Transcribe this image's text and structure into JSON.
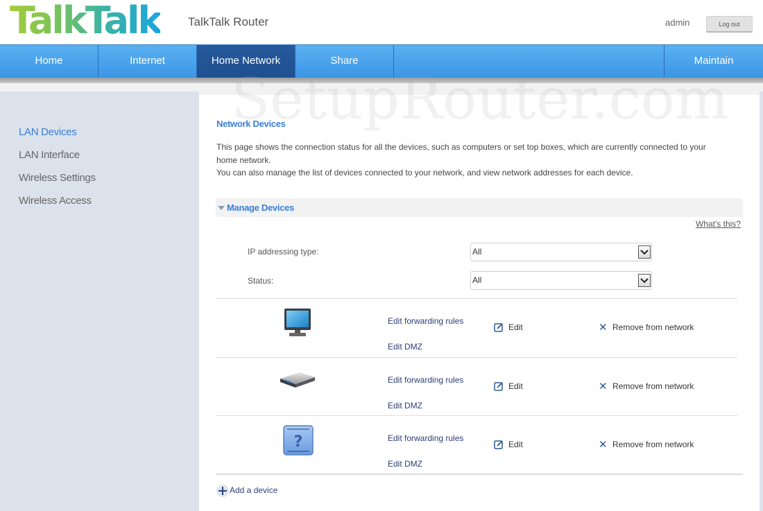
{
  "header": {
    "logo": "TalkTalk",
    "app_title": "TalkTalk Router",
    "user": "admin",
    "logout_label": "Log out"
  },
  "nav": {
    "items": [
      {
        "label": "Home",
        "active": false
      },
      {
        "label": "Internet",
        "active": false
      },
      {
        "label": "Home Network",
        "active": true
      },
      {
        "label": "Share",
        "active": false
      },
      {
        "label": "Maintain",
        "active": false
      }
    ]
  },
  "watermark": "SetupRouter.com",
  "sidebar": {
    "items": [
      {
        "label": "LAN Devices",
        "active": true
      },
      {
        "label": "LAN Interface",
        "active": false
      },
      {
        "label": "Wireless Settings",
        "active": false
      },
      {
        "label": "Wireless Access",
        "active": false
      }
    ]
  },
  "main": {
    "title": "Network Devices",
    "description": [
      "This page shows the connection status for all the devices, such as computers or set top boxes, which are currently connected to your",
      "home network.",
      "You can also manage the list of devices connected to your network, and view network addresses for each device."
    ],
    "section": {
      "title": "Manage Devices",
      "help_link": "What's this?"
    },
    "filters": [
      {
        "label": "IP addressing type:",
        "value": "All"
      },
      {
        "label": "Status:",
        "value": "All"
      }
    ],
    "devices": [
      {
        "icon": "computer-monitor-icon",
        "forwarding_label": "Edit forwarding rules",
        "dmz_label": "Edit DMZ",
        "edit_label": "Edit",
        "remove_label": "Remove from network"
      },
      {
        "icon": "set-top-box-icon",
        "forwarding_label": "Edit forwarding rules",
        "dmz_label": "Edit DMZ",
        "edit_label": "Edit",
        "remove_label": "Remove from network"
      },
      {
        "icon": "unknown-device-icon",
        "forwarding_label": "Edit forwarding rules",
        "dmz_label": "Edit DMZ",
        "edit_label": "Edit",
        "remove_label": "Remove from network"
      }
    ],
    "add_device_label": "Add a device"
  },
  "colors": {
    "nav_blue": "#4aa3ee",
    "nav_active": "#24569a",
    "accent_link": "#3a7fd5",
    "action_link": "#2c3e7a",
    "sidebar_bg": "#dbe2ec"
  }
}
